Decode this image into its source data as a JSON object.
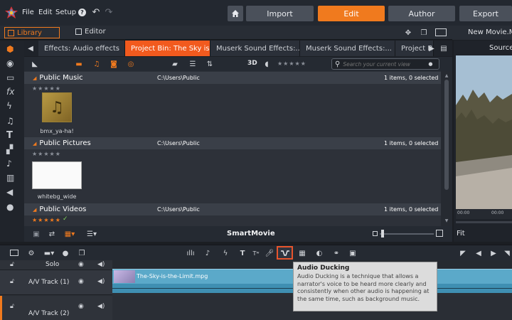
{
  "menu": {
    "file": "File",
    "edit": "Edit",
    "setup": "Setup"
  },
  "main_tabs": {
    "import": "Import",
    "edit": "Edit",
    "author": "Author",
    "export": "Export"
  },
  "panel_tabs": {
    "library": "Library",
    "editor": "Editor",
    "movie": "New Movie.Mo"
  },
  "bin_tabs": [
    {
      "label": "Effects: Audio effects"
    },
    {
      "label": "Project Bin: The Sky is..."
    },
    {
      "label": "Muserk Sound Effects:..."
    },
    {
      "label": "Muserk Sound Effects:..."
    },
    {
      "label": "Project B"
    }
  ],
  "toolbar": {
    "three_d": "3D",
    "stars": "★★★★★",
    "search_placeholder": "Search your current view"
  },
  "groups": [
    {
      "name": "Public Music",
      "path": "C:\\Users\\Public",
      "count": "1 items, 0 selected",
      "stars": "★★★★★",
      "item": "bmx_ya-ha!"
    },
    {
      "name": "Public Pictures",
      "path": "C:\\Users\\Public",
      "count": "1 items, 0 selected",
      "stars": "★★★★★",
      "item": "whitebg_wide"
    },
    {
      "name": "Public Videos",
      "path": "C:\\Users\\Public",
      "count": "1 items, 0 selected",
      "stars": "★★★★★"
    }
  ],
  "bottom": {
    "smartmovie": "SmartMovie"
  },
  "preview": {
    "title": "Source",
    "fit": "Fit",
    "time1": "00:00",
    "time2": "00:00"
  },
  "timeline": {
    "solo": "Solo",
    "track1": "A/V Track (1)",
    "track2": "A/V Track (2)",
    "clip": "The-Sky-is-the-Limit.mpg",
    "T": "T",
    "Tw": "Tʷ"
  },
  "tooltip": {
    "title": "Audio Ducking",
    "body": "Audio Ducking is a technique that allows a narrator's voice to be heard more clearly and consistently when other audio is happening at the same time, such as background music."
  },
  "colors": {
    "accent": "#f07a1e",
    "active_tab": "#f25a1e",
    "clip": "#5ba9c9"
  }
}
